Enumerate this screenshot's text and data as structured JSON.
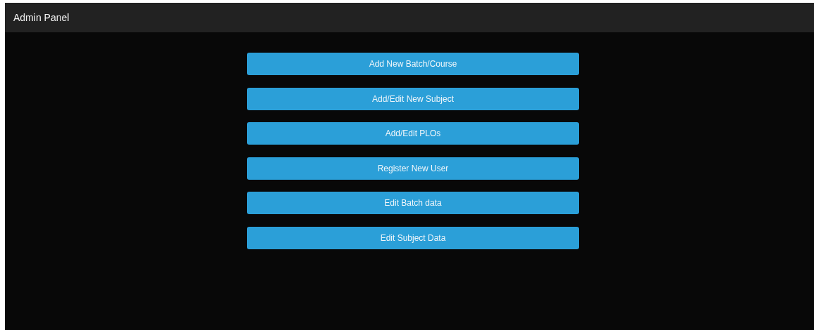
{
  "header": {
    "title": "Admin Panel"
  },
  "buttons": [
    "Add New Batch/Course",
    "Add/Edit New Subject",
    "Add/Edit PLOs",
    "Register New User",
    "Edit Batch data",
    "Edit Subject Data"
  ]
}
